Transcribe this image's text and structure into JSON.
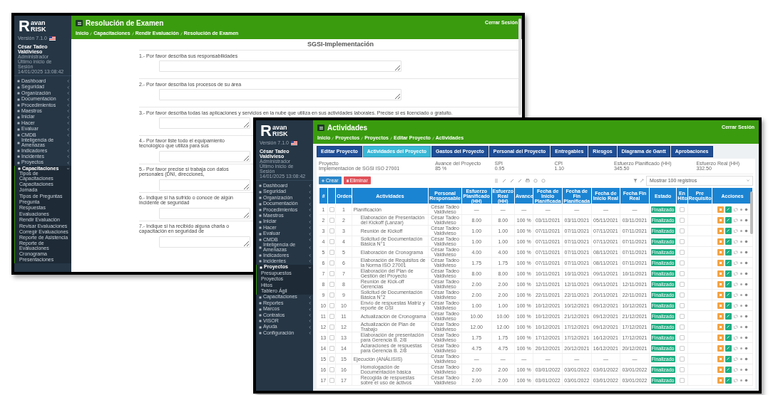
{
  "exam_window": {
    "brand": {
      "initial": "R",
      "top": "avan",
      "bottom": "RISK"
    },
    "version": "Versión 7.1.0",
    "user": {
      "name": "César Tadeo Valdivieso",
      "role": "Administrador",
      "last_login_label": "Último inicio de Sesión",
      "last_login": "14/01/2025 13:08:42"
    },
    "menu": [
      {
        "label": "Dashboard",
        "expanded": false
      },
      {
        "label": "Seguridad",
        "expanded": false
      },
      {
        "label": "Organización",
        "expanded": false
      },
      {
        "label": "Documentación",
        "expanded": false
      },
      {
        "label": "Procedimientos",
        "expanded": false
      },
      {
        "label": "Maestros",
        "expanded": false
      },
      {
        "label": "Iniciar",
        "expanded": false
      },
      {
        "label": "Hacer",
        "expanded": false
      },
      {
        "label": "Evaluar",
        "expanded": false
      },
      {
        "label": "CMDB",
        "expanded": false
      },
      {
        "label": "Inteligencia de Amenazas",
        "expanded": false
      },
      {
        "label": "Indicadores",
        "expanded": false
      },
      {
        "label": "Incidentes",
        "expanded": false
      },
      {
        "label": "Proyectos",
        "expanded": false
      },
      {
        "label": "Capacitaciones",
        "expanded": true,
        "children": [
          {
            "label": "Tipos de Capacitaciones"
          },
          {
            "label": "Capacitaciones"
          },
          {
            "label": "Jornada"
          },
          {
            "label": "Tipos de Preguntas"
          },
          {
            "label": "Pregunta"
          },
          {
            "label": "Respuestas"
          },
          {
            "label": "Evaluaciones"
          },
          {
            "label": "Rendir Evaluación"
          },
          {
            "label": "Revisar Evaluaciones"
          },
          {
            "label": "Corregir Evaluaciones"
          },
          {
            "label": "Reporte de Asistencia"
          },
          {
            "label": "Reporte de Evaluaciones"
          },
          {
            "label": "Cronograma"
          },
          {
            "label": "Presentaciones"
          }
        ]
      }
    ],
    "title": "Resolución de Examen",
    "breadcrumb": [
      "Inicio",
      "Capacitaciones",
      "Rendir Evaluación",
      "Resolución de Examen"
    ],
    "logout": "Cerrar Sesión",
    "exam_title": "SGSI-Implementación",
    "questions": [
      "1.- Por favor describa sus responsabilidades",
      "2.- Por favor describa los procesos de su área",
      "3.- Por favor describa todas las aplicaciones y servicios en la nube que utiliza en sus actividades laborales. Precise si es licenciado o gratuito.",
      "4.- Por favor liste todo el equipamiento tecnológico que utiliza para sus",
      "5.- Por favor precise si trabaja con datos personales (DNI, direcciones,",
      "6.- Indique si ha sufrido o conoce de algún incidente de seguridad",
      "7.- Indique si ha recibido alguna charla o capacitación en seguridad de"
    ]
  },
  "activities_window": {
    "brand": {
      "initial": "R",
      "top": "avan",
      "bottom": "RISK"
    },
    "version": "Versión 7.1.0",
    "user": {
      "name": "César Tadeo Valdivieso",
      "role": "Administrador",
      "last_login_label": "Último inicio de Sesión",
      "last_login": "14/01/2025 13:08:42"
    },
    "menu": [
      {
        "label": "Dashboard",
        "expanded": false
      },
      {
        "label": "Seguridad",
        "expanded": false
      },
      {
        "label": "Organización",
        "expanded": false
      },
      {
        "label": "Documentación",
        "expanded": false
      },
      {
        "label": "Procedimientos",
        "expanded": false
      },
      {
        "label": "Maestros",
        "expanded": false
      },
      {
        "label": "Iniciar",
        "expanded": false
      },
      {
        "label": "Hacer",
        "expanded": false
      },
      {
        "label": "Evaluar",
        "expanded": false
      },
      {
        "label": "CMDB",
        "expanded": false
      },
      {
        "label": "Inteligencia de Amenazas",
        "expanded": false
      },
      {
        "label": "Indicadores",
        "expanded": false
      },
      {
        "label": "Incidentes",
        "expanded": false
      },
      {
        "label": "Proyectos",
        "expanded": true,
        "children": [
          {
            "label": "Presupuestos"
          },
          {
            "label": "Proyectos"
          },
          {
            "label": "Hitos"
          },
          {
            "label": "Tablero Ágil"
          }
        ]
      },
      {
        "label": "Capacitaciones",
        "expanded": false
      },
      {
        "label": "Reportes",
        "expanded": false
      },
      {
        "label": "Marcos",
        "expanded": false
      },
      {
        "label": "Contratos",
        "expanded": false
      },
      {
        "label": "VISOR",
        "expanded": false
      },
      {
        "label": "Ayuda",
        "expanded": false
      },
      {
        "label": "Configuración",
        "expanded": false
      }
    ],
    "title": "Actividades",
    "breadcrumb": [
      "Inicio",
      "Proyectos",
      "Proyectos",
      "Editar Proyecto",
      "Actividades"
    ],
    "logout": "Cerrar Sesión",
    "tabs": [
      {
        "label": "Editar Proyecto",
        "selected": false
      },
      {
        "label": "Actividades del Proyecto",
        "selected": true
      },
      {
        "label": "Gastos del Proyecto",
        "selected": false
      },
      {
        "label": "Personal del Proyecto",
        "selected": false
      },
      {
        "label": "Entregables",
        "selected": false
      },
      {
        "label": "Riesgos",
        "selected": false
      },
      {
        "label": "Diagrama de Gantt",
        "selected": false
      },
      {
        "label": "Aprobaciones",
        "selected": false
      }
    ],
    "summary": [
      {
        "label": "Proyecto",
        "value": "Implementación de SGSI ISO 27001"
      },
      {
        "label": "Avance del Proyecto",
        "value": "85 %"
      },
      {
        "label": "SPI",
        "value": "0.95"
      },
      {
        "label": "CPI",
        "value": "1.10"
      },
      {
        "label": "Esfuerzo Planificado (HH)",
        "value": "345.50"
      },
      {
        "label": "Esfuerzo Real (HH)",
        "value": "332.50"
      }
    ],
    "create_button": "Crear",
    "delete_button": "Eliminar",
    "page_size": "Mostrar 100 registros",
    "columns": [
      "#",
      "Orden",
      "Actividades",
      "Personal Responsable",
      "Esfuerzo Planificado (HH)",
      "Esfuerzo Real (HH)",
      "Avance",
      "Fecha de Inicio Planificada",
      "Fecha de Fin Planificada",
      "Fecha de Inicio Real",
      "Fecha Fin Real",
      "Estado",
      "En Hito",
      "Pre Requisito",
      "Acciones"
    ],
    "rows": [
      {
        "num": "1",
        "order": "1",
        "activity": "Planificación",
        "person": "César Tadeo Valdivieso",
        "plan": "—",
        "real": "—",
        "progress": "—",
        "start_plan": "—",
        "end_plan": "—",
        "start_real": "—",
        "end_real": "—",
        "status": "Finalizado",
        "milestone": false,
        "selected": false,
        "children": [
          {
            "num": "2",
            "order": "2",
            "activity": "Elaboración de Presentación del Kickoff (Lanzar)",
            "person": "César Tadeo Valdivieso",
            "plan": "8.00",
            "real": "8.00",
            "progress": "100 %",
            "start_plan": "03/11/2021",
            "end_plan": "03/11/2021",
            "start_real": "05/11/2021",
            "end_real": "03/11/2021",
            "status": "Finalizado",
            "milestone": false,
            "selected": false
          },
          {
            "num": "3",
            "order": "3",
            "activity": "Reunión de Kickoff",
            "person": "César Tadeo Valdivieso",
            "plan": "1.00",
            "real": "1.00",
            "progress": "100 %",
            "start_plan": "07/11/2021",
            "end_plan": "07/11/2021",
            "start_real": "07/11/2021",
            "end_real": "07/11/2021",
            "status": "Finalizado",
            "milestone": false,
            "selected": false
          },
          {
            "num": "4",
            "order": "4",
            "activity": "Solicitud de Documentación Básica N°1",
            "person": "César Tadeo Valdivieso",
            "plan": "1.00",
            "real": "1.00",
            "progress": "100 %",
            "start_plan": "07/11/2021",
            "end_plan": "07/11/2021",
            "start_real": "07/11/2021",
            "end_real": "07/11/2021",
            "status": "Finalizado",
            "milestone": false,
            "selected": false
          },
          {
            "num": "5",
            "order": "5",
            "activity": "Elaboración de Cronograma",
            "person": "César Tadeo Valdivieso",
            "plan": "4.00",
            "real": "4.00",
            "progress": "100 %",
            "start_plan": "07/11/2021",
            "end_plan": "07/11/2021",
            "start_real": "08/11/2021",
            "end_real": "07/11/2021",
            "status": "Finalizado",
            "milestone": false,
            "selected": false
          },
          {
            "num": "6",
            "order": "6",
            "activity": "Elaboración de Requisitos de la Norma ISO 27001",
            "person": "César Tadeo Valdivieso",
            "plan": "1.75",
            "real": "1.75",
            "progress": "100 %",
            "start_plan": "07/11/2021",
            "end_plan": "07/11/2021",
            "start_real": "08/11/2021",
            "end_real": "07/11/2021",
            "status": "Finalizado",
            "milestone": false,
            "selected": false
          },
          {
            "num": "7",
            "order": "7",
            "activity": "Elaboración del Plan de Gestión del Proyecto",
            "person": "César Tadeo Valdivieso",
            "plan": "8.00",
            "real": "8.00",
            "progress": "100 %",
            "start_plan": "10/11/2021",
            "end_plan": "10/11/2021",
            "start_real": "09/11/2021",
            "end_real": "10/11/2021",
            "status": "Finalizado",
            "milestone": false,
            "selected": false
          },
          {
            "num": "8",
            "order": "8",
            "activity": "Reunión de Kick-off Gerencias",
            "person": "César Tadeo Valdivieso",
            "plan": "2.00",
            "real": "2.00",
            "progress": "100 %",
            "start_plan": "12/11/2021",
            "end_plan": "12/11/2021",
            "start_real": "09/11/2021",
            "end_real": "12/11/2021",
            "status": "Finalizado",
            "milestone": false,
            "selected": false
          },
          {
            "num": "9",
            "order": "9",
            "activity": "Solicitud de Documentación Básica N°2",
            "person": "César Tadeo Valdivieso",
            "plan": "2.00",
            "real": "2.00",
            "progress": "100 %",
            "start_plan": "22/11/2021",
            "end_plan": "22/11/2021",
            "start_real": "20/11/2021",
            "end_real": "22/11/2021",
            "status": "Finalizado",
            "milestone": false,
            "selected": false
          },
          {
            "num": "10",
            "order": "10",
            "activity": "Envío de respuestas Matriz y reporte de GSI",
            "person": "César Tadeo Valdivieso",
            "plan": "1.00",
            "real": "1.00",
            "progress": "100 %",
            "start_plan": "10/12/2021",
            "end_plan": "10/12/2021",
            "start_real": "09/12/2021",
            "end_real": "10/12/2021",
            "status": "Finalizado",
            "milestone": false,
            "selected": false
          },
          {
            "num": "11",
            "order": "11",
            "activity": "Actualización de Cronograma",
            "person": "César Tadeo Valdivieso",
            "plan": "10.00",
            "real": "10.00",
            "progress": "100 %",
            "start_plan": "10/12/2021",
            "end_plan": "21/12/2021",
            "start_real": "09/12/2021",
            "end_real": "21/12/2021",
            "status": "Finalizado",
            "milestone": false,
            "selected": false
          },
          {
            "num": "12",
            "order": "12",
            "activity": "Actualización de Plan de Trabajo",
            "person": "César Tadeo Valdivieso",
            "plan": "12.00",
            "real": "12.00",
            "progress": "100 %",
            "start_plan": "10/12/2021",
            "end_plan": "17/12/2021",
            "start_real": "09/12/2021",
            "end_real": "17/12/2021",
            "status": "Finalizado",
            "milestone": false,
            "selected": false
          },
          {
            "num": "13",
            "order": "13",
            "activity": "Elaboración de presentación para Gerencia B. 2/8",
            "person": "César Tadeo Valdivieso",
            "plan": "1.75",
            "real": "1.75",
            "progress": "100 %",
            "start_plan": "17/12/2021",
            "end_plan": "17/12/2021",
            "start_real": "16/12/2021",
            "end_real": "17/12/2021",
            "status": "Finalizado",
            "milestone": false,
            "selected": false
          },
          {
            "num": "14",
            "order": "14",
            "activity": "Aclaraciones de respuestas para Gerencia B. 2/8",
            "person": "César Tadeo Valdivieso",
            "plan": "4.75",
            "real": "4.75",
            "progress": "100 %",
            "start_plan": "20/12/2021",
            "end_plan": "20/12/2021",
            "start_real": "16/12/2021",
            "end_real": "20/12/2021",
            "status": "Finalizado",
            "milestone": false,
            "selected": false
          }
        ]
      },
      {
        "num": "15",
        "order": "15",
        "activity": "Ejecución (ANÁLISIS)",
        "person": "César Tadeo Valdivieso",
        "plan": "—",
        "real": "—",
        "progress": "—",
        "start_plan": "—",
        "end_plan": "—",
        "start_real": "—",
        "end_real": "—",
        "status": "Finalizado",
        "milestone": false,
        "selected": false,
        "children": [
          {
            "num": "16",
            "order": "16",
            "activity": "Homologación de Documentación básica",
            "person": "César Tadeo Valdivieso",
            "plan": "2.00",
            "real": "2.00",
            "progress": "100 %",
            "start_plan": "03/01/2022",
            "end_plan": "03/01/2022",
            "start_real": "03/01/2022",
            "end_real": "03/01/2022",
            "status": "Finalizado",
            "milestone": false,
            "selected": false
          },
          {
            "num": "17",
            "order": "17",
            "activity": "Recogida de respuestas sobre el uso de activos",
            "person": "César Tadeo Valdivieso",
            "plan": "2.00",
            "real": "2.00",
            "progress": "100 %",
            "start_plan": "03/01/2022",
            "end_plan": "03/01/2022",
            "start_real": "03/01/2022",
            "end_real": "03/01/2022",
            "status": "Finalizado",
            "milestone": false,
            "selected": false
          }
        ]
      }
    ]
  }
}
